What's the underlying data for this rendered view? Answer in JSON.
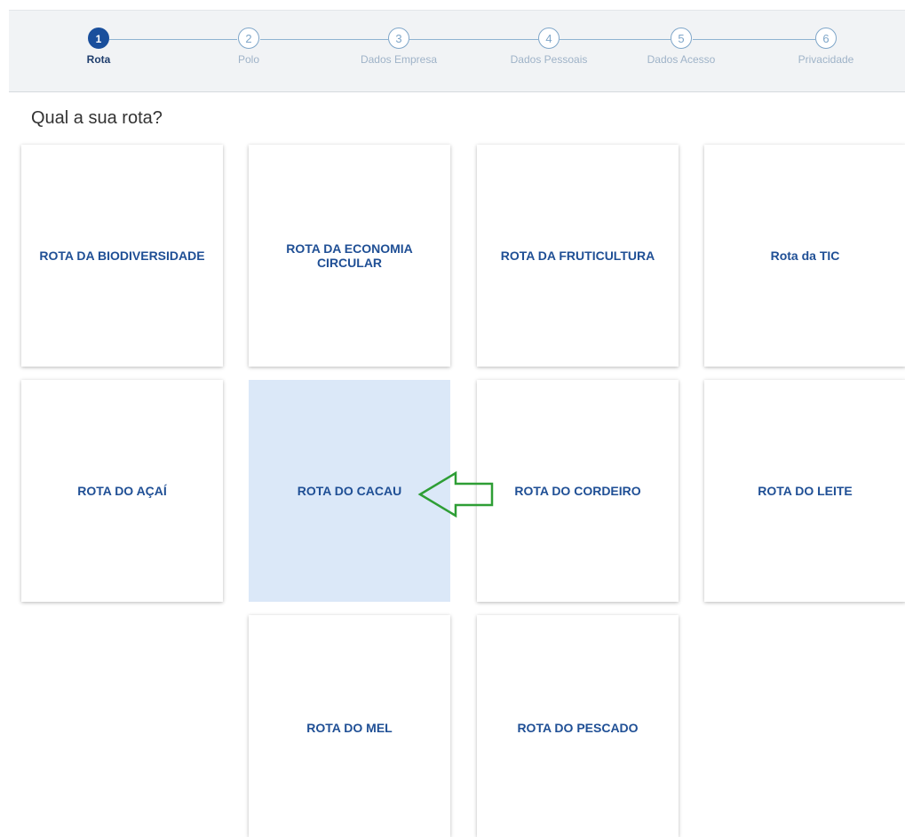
{
  "stepper": {
    "steps": [
      {
        "number": "1",
        "label": "Rota"
      },
      {
        "number": "2",
        "label": "Polo"
      },
      {
        "number": "3",
        "label": "Dados Empresa"
      },
      {
        "number": "4",
        "label": "Dados Pessoais"
      },
      {
        "number": "5",
        "label": "Dados Acesso"
      },
      {
        "number": "6",
        "label": "Privacidade"
      }
    ],
    "active_step": 1
  },
  "question": "Qual a sua rota?",
  "routes": [
    {
      "label": "ROTA DA BIODIVERSIDADE"
    },
    {
      "label": "ROTA DA ECONOMIA CIRCULAR"
    },
    {
      "label": "ROTA DA FRUTICULTURA"
    },
    {
      "label": "Rota da TIC"
    },
    {
      "label": "ROTA DO AÇAÍ"
    },
    {
      "label": "ROTA DO CACAU",
      "selected": true
    },
    {
      "label": "ROTA DO CORDEIRO"
    },
    {
      "label": "ROTA DO LEITE"
    },
    {
      "label": "ROTA DO MEL"
    },
    {
      "label": "ROTA DO PESCADO"
    }
  ],
  "annotation": {
    "icon": "arrow-left-icon",
    "color": "#2e9e35"
  },
  "colors": {
    "accent": "#1a4f9c",
    "selected_card": "#dbe8f8",
    "card_text": "#1f4f95"
  }
}
